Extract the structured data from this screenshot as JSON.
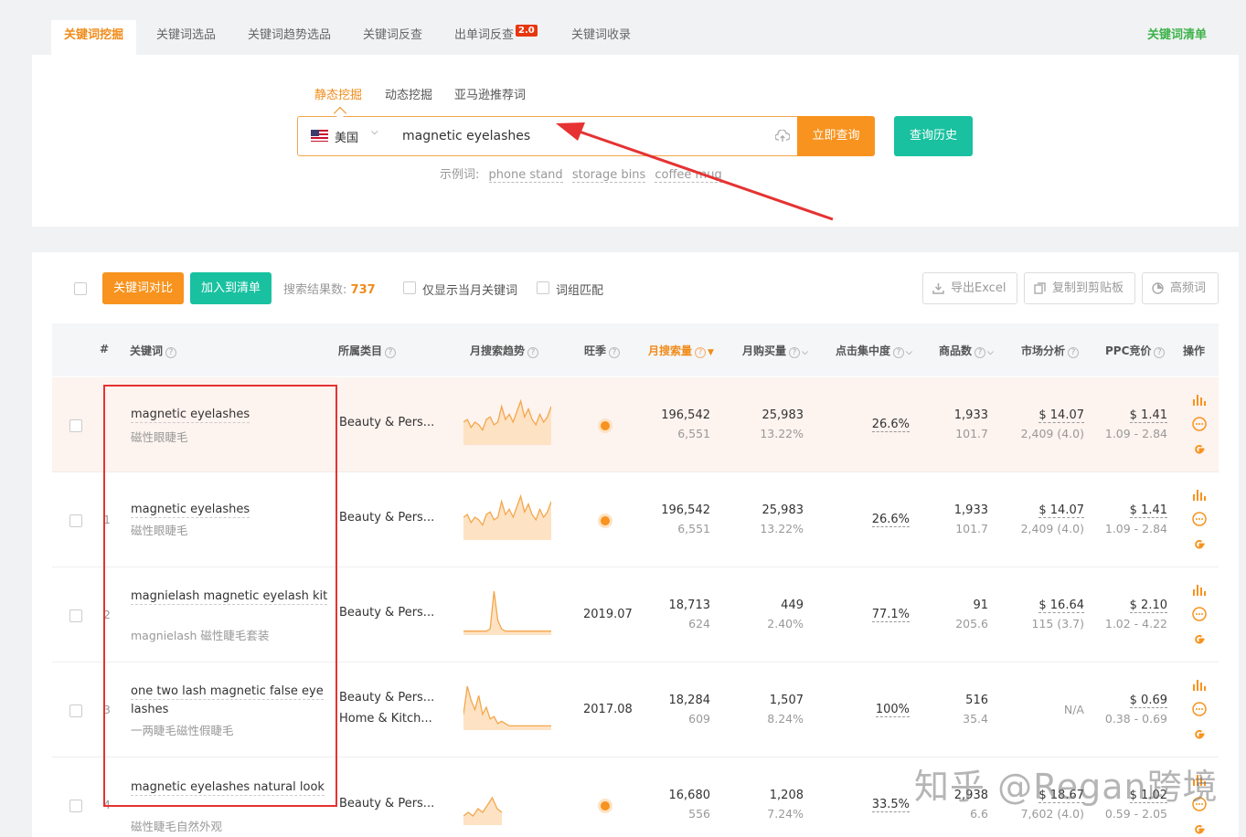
{
  "top_tabs": [
    {
      "label": "关键词挖掘",
      "active": true
    },
    {
      "label": "关键词选品",
      "active": false
    },
    {
      "label": "关键词趋势选品",
      "active": false
    },
    {
      "label": "关键词反查",
      "active": false
    },
    {
      "label": "出单词反查",
      "active": false,
      "badge": "2.0"
    },
    {
      "label": "关键词收录",
      "active": false
    }
  ],
  "keyword_list_link": "关键词清单",
  "search": {
    "sub_tabs": [
      "静态挖掘",
      "动态挖掘",
      "亚马逊推荐词"
    ],
    "country": "美国",
    "query": "magnetic eyelashes",
    "query_button": "立即查询",
    "history_button": "查询历史",
    "examples_label": "示例词:",
    "examples": [
      "phone stand",
      "storage bins",
      "coffee mug"
    ]
  },
  "toolbar": {
    "compare_button": "关键词对比",
    "add_button": "加入到清单",
    "result_count_label": "搜索结果数:",
    "result_count": "737",
    "option_month": "仅显示当月关键词",
    "option_phrase": "词组匹配",
    "export_button": "导出Excel",
    "copy_button": "复制到剪贴板",
    "freq_button": "高频词"
  },
  "table": {
    "headers": {
      "index": "#",
      "keyword": "关键词",
      "category": "所属类目",
      "trend": "月搜索趋势",
      "season": "旺季",
      "search_volume": "月搜索量",
      "purchases": "月购买量",
      "click_concentration": "点击集中度",
      "products": "商品数",
      "market": "市场分析",
      "ppc": "PPC竞价",
      "ops": "操作"
    },
    "rows": [
      {
        "index": "",
        "keyword": "magnetic eyelashes",
        "zh": "磁性眼睫毛",
        "category1": "Beauty & Pers...",
        "category2": "",
        "trend": [
          8,
          9,
          6,
          8,
          7,
          5,
          9,
          10,
          7,
          8,
          14,
          9,
          11,
          8,
          12,
          16,
          10,
          13,
          9,
          7,
          11,
          8,
          10,
          14
        ],
        "season": "",
        "season_dot": true,
        "volume": "196,542",
        "volume_sub": "6,551",
        "purchases": "25,983",
        "purchases_sub": "13.22%",
        "click": "26.6%",
        "products": "1,933",
        "products_sub": "101.7",
        "market": "$ 14.07",
        "market_sub": "2,409 (4.0)",
        "ppc": "$ 1.41",
        "ppc_sub": "1.09 - 2.84",
        "highlight": true
      },
      {
        "index": "1",
        "keyword": "magnetic eyelashes",
        "zh": "磁性眼睫毛",
        "category1": "Beauty & Pers...",
        "category2": "",
        "trend": [
          8,
          9,
          6,
          8,
          7,
          5,
          9,
          10,
          7,
          8,
          14,
          9,
          11,
          8,
          12,
          16,
          10,
          13,
          9,
          7,
          11,
          8,
          10,
          14
        ],
        "season": "",
        "season_dot": true,
        "volume": "196,542",
        "volume_sub": "6,551",
        "purchases": "25,983",
        "purchases_sub": "13.22%",
        "click": "26.6%",
        "products": "1,933",
        "products_sub": "101.7",
        "market": "$ 14.07",
        "market_sub": "2,409 (4.0)",
        "ppc": "$ 1.41",
        "ppc_sub": "1.09 - 2.84",
        "highlight": false
      },
      {
        "index": "2",
        "keyword": "magnielash magnetic eyelash kit",
        "zh": "magnielash 磁性睫毛套装",
        "category1": "Beauty & Pers...",
        "category2": "",
        "trend": [
          1,
          1,
          1,
          1,
          1,
          1,
          1,
          2,
          20,
          6,
          2,
          1,
          1,
          1,
          1,
          1,
          1,
          1,
          1,
          1,
          1,
          1,
          1,
          1
        ],
        "season": "2019.07",
        "season_dot": false,
        "volume": "18,713",
        "volume_sub": "624",
        "purchases": "449",
        "purchases_sub": "2.40%",
        "click": "77.1%",
        "products": "91",
        "products_sub": "205.6",
        "market": "$ 16.64",
        "market_sub": "115 (3.7)",
        "ppc": "$ 2.10",
        "ppc_sub": "1.02 - 4.22",
        "highlight": false
      },
      {
        "index": "3",
        "keyword": "one two lash magnetic false eye",
        "keyword2": "lashes",
        "zh": "一两睫毛磁性假睫毛",
        "category1": "Beauty & Pers...",
        "category2": "Home & Kitch...",
        "trend": [
          6,
          18,
          12,
          8,
          14,
          6,
          9,
          4,
          5,
          2,
          3,
          2,
          1,
          1,
          1,
          1,
          1,
          1,
          1,
          1,
          1,
          1,
          1,
          1
        ],
        "season": "2017.08",
        "season_dot": false,
        "volume": "18,284",
        "volume_sub": "609",
        "purchases": "1,507",
        "purchases_sub": "8.24%",
        "click": "100%",
        "products": "516",
        "products_sub": "35.4",
        "market": "N/A",
        "market_sub": "",
        "ppc": "$ 0.69",
        "ppc_sub": "0.38 - 0.69",
        "highlight": false
      },
      {
        "index": "4",
        "keyword": "magnetic eyelashes natural look",
        "zh": "磁性睫毛自然外观",
        "category1": "Beauty & Pers...",
        "category2": "",
        "trend": [
          2,
          3,
          2,
          4,
          3,
          5,
          7,
          4,
          3
        ],
        "season": "",
        "season_dot": true,
        "volume": "16,680",
        "volume_sub": "556",
        "purchases": "1,208",
        "purchases_sub": "7.24%",
        "click": "33.5%",
        "products": "2,938",
        "products_sub": "6.6",
        "market": "$ 18.67",
        "market_sub": "7,602 (4.0)",
        "ppc": "$ 1.02",
        "ppc_sub": "0.59 - 2.05",
        "highlight": false
      }
    ]
  },
  "watermark": "知乎 @Regan跨境",
  "colors": {
    "accent_orange": "#f7931e",
    "accent_green": "#19c1a0",
    "annotation_red": "#e63232"
  }
}
